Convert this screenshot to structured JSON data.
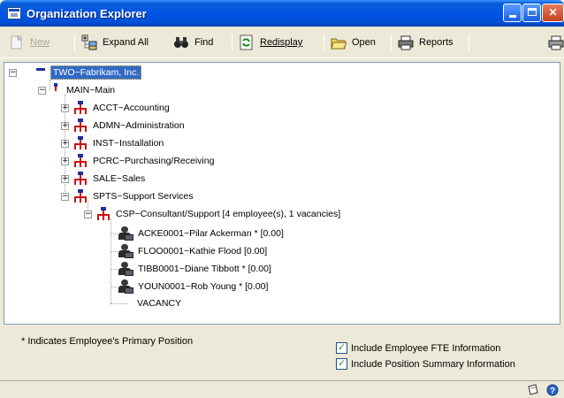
{
  "window": {
    "title": "Organization Explorer",
    "controls": {
      "minimize": "minimize",
      "maximize": "maximize",
      "close": "close"
    }
  },
  "toolbar": {
    "new_label": "New",
    "expand_all_label": "Expand All",
    "find_label": "Find",
    "redisplay_label": "Redisplay",
    "open_label": "Open",
    "reports_label": "Reports"
  },
  "tree": {
    "root": "TWO~Fabrikam, Inc.",
    "main": "MAIN~Main",
    "departments": [
      "ACCT~Accounting",
      "ADMN~Administration",
      "INST~Installation",
      "PCRC~Purchasing/Receiving",
      "SALE~Sales",
      "SPTS~Support Services"
    ],
    "position": "CSP~Consultant/Support [4 employee(s), 1 vacancies]",
    "employees": [
      "ACKE0001~Pilar Ackerman * [0.00]",
      "FLOO0001~Kathie Flood [0.00]",
      "TIBB0001~Diane Tibbott * [0.00]",
      "YOUN0001~Rob Young * [0.00]"
    ],
    "vacancy": "VACANCY"
  },
  "footer": {
    "note": "* Indicates Employee's Primary Position",
    "include_fte_label": "Include Employee FTE Information",
    "include_fte_checked": true,
    "include_summary_label": "Include Position Summary Information",
    "include_summary_checked": true
  },
  "colors": {
    "titlebar": "#0054e3",
    "selection": "#316ac5",
    "org_icon_red": "#cc1010",
    "org_icon_blue": "#1c2f9c"
  }
}
